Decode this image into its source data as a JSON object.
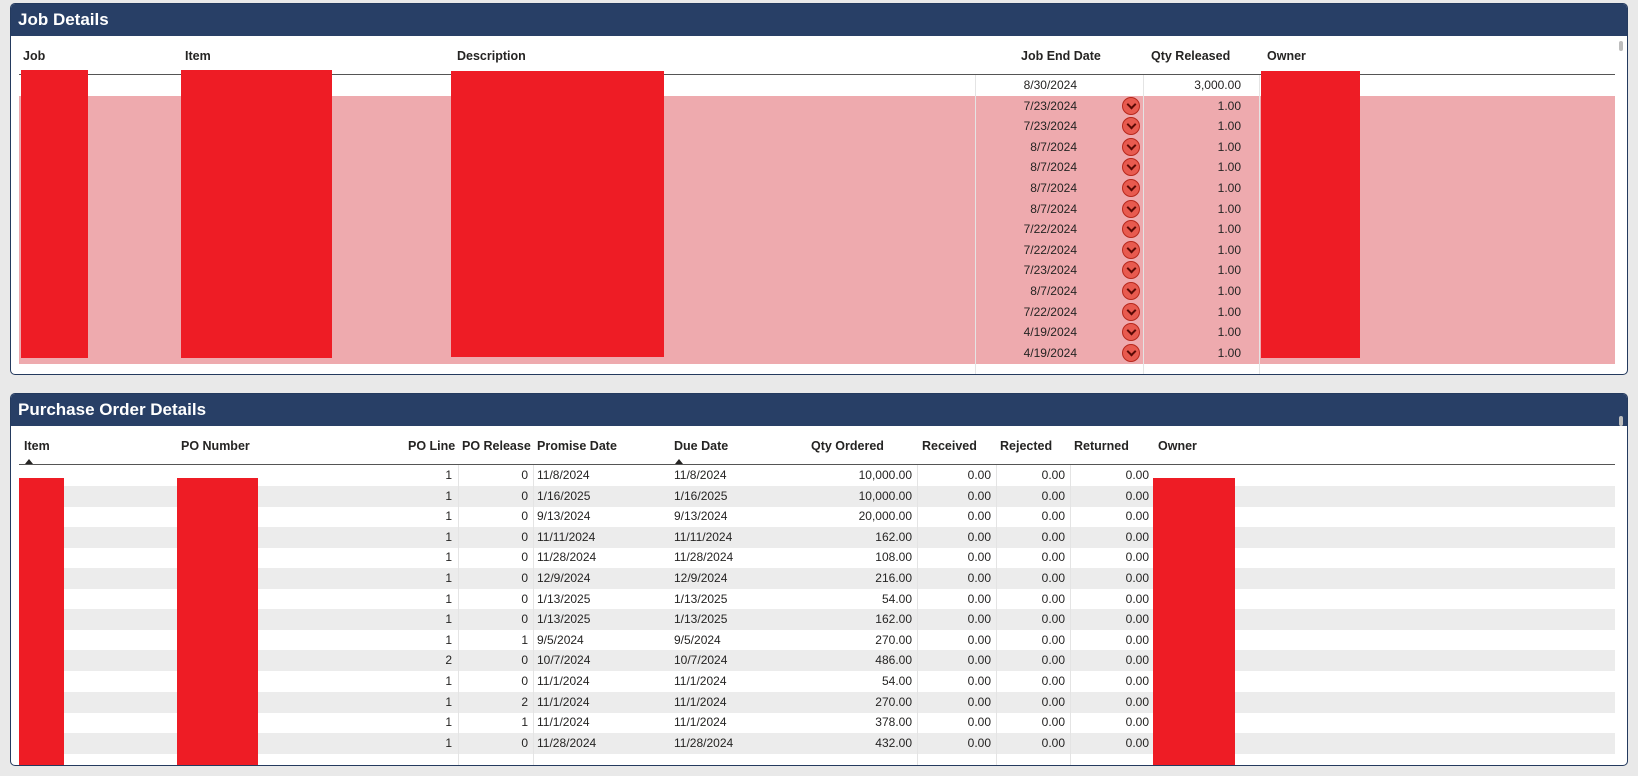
{
  "job_details": {
    "title": "Job Details",
    "columns": {
      "job": "Job",
      "item": "Item",
      "description": "Description",
      "end_date": "Job End Date",
      "qty_released": "Qty Released",
      "owner": "Owner"
    },
    "rows": [
      {
        "end_date": "8/30/2024",
        "qty": "3,000.00",
        "flagged": false
      },
      {
        "end_date": "7/23/2024",
        "qty": "1.00",
        "flagged": true
      },
      {
        "end_date": "7/23/2024",
        "qty": "1.00",
        "flagged": true
      },
      {
        "end_date": "8/7/2024",
        "qty": "1.00",
        "flagged": true
      },
      {
        "end_date": "8/7/2024",
        "qty": "1.00",
        "flagged": true
      },
      {
        "end_date": "8/7/2024",
        "qty": "1.00",
        "flagged": true
      },
      {
        "end_date": "8/7/2024",
        "qty": "1.00",
        "flagged": true
      },
      {
        "end_date": "7/22/2024",
        "qty": "1.00",
        "flagged": true
      },
      {
        "end_date": "7/22/2024",
        "qty": "1.00",
        "flagged": true
      },
      {
        "end_date": "7/23/2024",
        "qty": "1.00",
        "flagged": true
      },
      {
        "end_date": "8/7/2024",
        "qty": "1.00",
        "flagged": true
      },
      {
        "end_date": "7/22/2024",
        "qty": "1.00",
        "flagged": true
      },
      {
        "end_date": "4/19/2024",
        "qty": "1.00",
        "flagged": true
      },
      {
        "end_date": "4/19/2024",
        "qty": "1.00",
        "flagged": true
      }
    ]
  },
  "po_details": {
    "title": "Purchase Order Details",
    "columns": {
      "item": "Item",
      "po_number": "PO Number",
      "po_line": "PO Line",
      "po_release": "PO Release",
      "promise_date": "Promise Date",
      "due_date": "Due Date",
      "qty_ordered": "Qty Ordered",
      "received": "Received",
      "rejected": "Rejected",
      "returned": "Returned",
      "owner": "Owner"
    },
    "rows": [
      {
        "line": "1",
        "release": "0",
        "promise": "11/8/2024",
        "due": "11/8/2024",
        "qty": "10,000.00",
        "received": "0.00",
        "rejected": "0.00",
        "returned": "0.00"
      },
      {
        "line": "1",
        "release": "0",
        "promise": "1/16/2025",
        "due": "1/16/2025",
        "qty": "10,000.00",
        "received": "0.00",
        "rejected": "0.00",
        "returned": "0.00"
      },
      {
        "line": "1",
        "release": "0",
        "promise": "9/13/2024",
        "due": "9/13/2024",
        "qty": "20,000.00",
        "received": "0.00",
        "rejected": "0.00",
        "returned": "0.00"
      },
      {
        "line": "1",
        "release": "0",
        "promise": "11/11/2024",
        "due": "11/11/2024",
        "qty": "162.00",
        "received": "0.00",
        "rejected": "0.00",
        "returned": "0.00"
      },
      {
        "line": "1",
        "release": "0",
        "promise": "11/28/2024",
        "due": "11/28/2024",
        "qty": "108.00",
        "received": "0.00",
        "rejected": "0.00",
        "returned": "0.00"
      },
      {
        "line": "1",
        "release": "0",
        "promise": "12/9/2024",
        "due": "12/9/2024",
        "qty": "216.00",
        "received": "0.00",
        "rejected": "0.00",
        "returned": "0.00"
      },
      {
        "line": "1",
        "release": "0",
        "promise": "1/13/2025",
        "due": "1/13/2025",
        "qty": "54.00",
        "received": "0.00",
        "rejected": "0.00",
        "returned": "0.00"
      },
      {
        "line": "1",
        "release": "0",
        "promise": "1/13/2025",
        "due": "1/13/2025",
        "qty": "162.00",
        "received": "0.00",
        "rejected": "0.00",
        "returned": "0.00"
      },
      {
        "line": "1",
        "release": "1",
        "promise": "9/5/2024",
        "due": "9/5/2024",
        "qty": "270.00",
        "received": "0.00",
        "rejected": "0.00",
        "returned": "0.00"
      },
      {
        "line": "2",
        "release": "0",
        "promise": "10/7/2024",
        "due": "10/7/2024",
        "qty": "486.00",
        "received": "0.00",
        "rejected": "0.00",
        "returned": "0.00"
      },
      {
        "line": "1",
        "release": "0",
        "promise": "11/1/2024",
        "due": "11/1/2024",
        "qty": "54.00",
        "received": "0.00",
        "rejected": "0.00",
        "returned": "0.00"
      },
      {
        "line": "1",
        "release": "2",
        "promise": "11/1/2024",
        "due": "11/1/2024",
        "qty": "270.00",
        "received": "0.00",
        "rejected": "0.00",
        "returned": "0.00"
      },
      {
        "line": "1",
        "release": "1",
        "promise": "11/1/2024",
        "due": "11/1/2024",
        "qty": "378.00",
        "received": "0.00",
        "rejected": "0.00",
        "returned": "0.00"
      },
      {
        "line": "1",
        "release": "0",
        "promise": "11/28/2024",
        "due": "11/28/2024",
        "qty": "432.00",
        "received": "0.00",
        "rejected": "0.00",
        "returned": "0.00"
      }
    ]
  },
  "colors": {
    "header_bg": "#283f66",
    "flag_row_bg": "#eeaaae",
    "redaction": "#ee1c25",
    "flag_icon": "#e85a4f"
  },
  "icons": {
    "flag": "chevron-down-circle-icon",
    "sort": "sort-ascending-icon"
  }
}
